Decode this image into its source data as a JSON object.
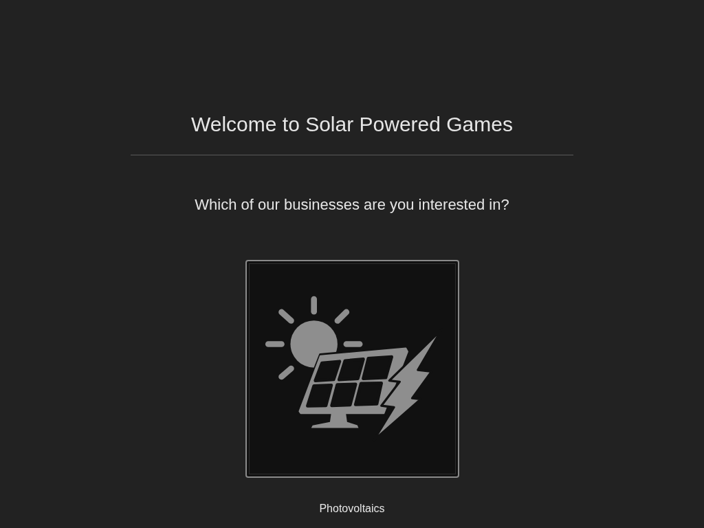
{
  "title": "Welcome to Solar Powered Games",
  "question": "Which of our businesses are you interested in?",
  "businesses": [
    {
      "label": "Photovoltaics"
    }
  ]
}
